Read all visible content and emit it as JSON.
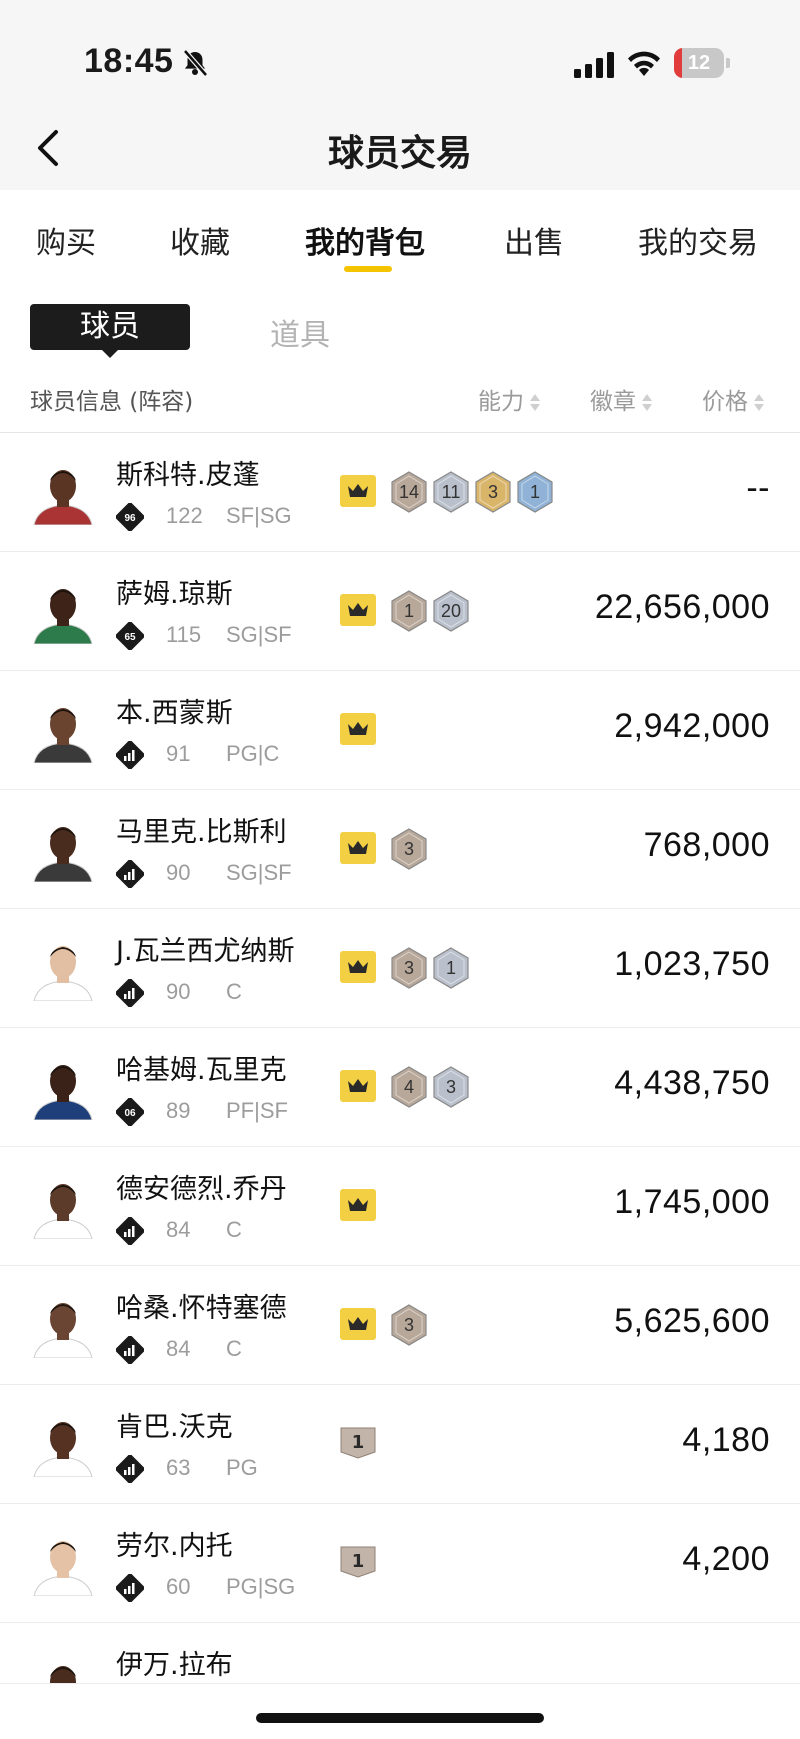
{
  "status_bar": {
    "time": "18:45",
    "battery": "12"
  },
  "nav": {
    "title": "球员交易"
  },
  "tabs": [
    {
      "label": "购买"
    },
    {
      "label": "收藏"
    },
    {
      "label": "我的背包",
      "active": true
    },
    {
      "label": "出售"
    },
    {
      "label": "我的交易"
    }
  ],
  "subtabs": {
    "active": "球员",
    "other": "道具"
  },
  "columns": {
    "info": "球员信息 (阵容)",
    "ability": "能力",
    "badge": "徽章",
    "price": "价格"
  },
  "colors": {
    "accent": "#f5c400",
    "crown": "#f2cf43",
    "bronze": "#b8a89a",
    "silver": "#b9c0cc",
    "gold": "#d9b56a",
    "blue": "#8fb2d6"
  },
  "players": [
    {
      "name": "斯科特.皮蓬",
      "tier": "96",
      "rating": "122",
      "position": "SF|SG",
      "badges": [
        {
          "type": "crown"
        },
        {
          "type": "hex",
          "color": "bronze",
          "value": "14"
        },
        {
          "type": "hex",
          "color": "silver",
          "value": "11"
        },
        {
          "type": "hex",
          "color": "gold",
          "value": "3"
        },
        {
          "type": "hex",
          "color": "blue",
          "value": "1"
        }
      ],
      "price": "--"
    },
    {
      "name": "萨姆.琼斯",
      "tier": "65",
      "rating": "115",
      "position": "SG|SF",
      "badges": [
        {
          "type": "crown"
        },
        {
          "type": "hex",
          "color": "bronze",
          "value": "1"
        },
        {
          "type": "hex",
          "color": "silver",
          "value": "20"
        }
      ],
      "price": "22,656,000"
    },
    {
      "name": "本.西蒙斯",
      "tier": "bars",
      "rating": "91",
      "position": "PG|C",
      "badges": [
        {
          "type": "crown"
        }
      ],
      "price": "2,942,000"
    },
    {
      "name": "马里克.比斯利",
      "tier": "bars",
      "rating": "90",
      "position": "SG|SF",
      "badges": [
        {
          "type": "crown"
        },
        {
          "type": "hex",
          "color": "bronze",
          "value": "3"
        }
      ],
      "price": "768,000"
    },
    {
      "name": "J.瓦兰西尤纳斯",
      "tier": "bars",
      "rating": "90",
      "position": "C",
      "badges": [
        {
          "type": "crown"
        },
        {
          "type": "hex",
          "color": "bronze",
          "value": "3"
        },
        {
          "type": "hex",
          "color": "silver",
          "value": "1"
        }
      ],
      "price": "1,023,750"
    },
    {
      "name": "哈基姆.瓦里克",
      "tier": "06",
      "rating": "89",
      "position": "PF|SF",
      "badges": [
        {
          "type": "crown"
        },
        {
          "type": "hex",
          "color": "bronze",
          "value": "4"
        },
        {
          "type": "hex",
          "color": "silver",
          "value": "3"
        }
      ],
      "price": "4,438,750"
    },
    {
      "name": "德安德烈.乔丹",
      "tier": "bars",
      "rating": "84",
      "position": "C",
      "badges": [
        {
          "type": "crown"
        }
      ],
      "price": "1,745,000"
    },
    {
      "name": "哈桑.怀特塞德",
      "tier": "bars",
      "rating": "84",
      "position": "C",
      "badges": [
        {
          "type": "crown"
        },
        {
          "type": "hex",
          "color": "bronze",
          "value": "3"
        }
      ],
      "price": "5,625,600"
    },
    {
      "name": "肯巴.沃克",
      "tier": "bars",
      "rating": "63",
      "position": "PG",
      "badges": [
        {
          "type": "tag",
          "value": "1"
        }
      ],
      "price": "4,180"
    },
    {
      "name": "劳尔.内托",
      "tier": "bars",
      "rating": "60",
      "position": "PG|SG",
      "badges": [
        {
          "type": "tag",
          "value": "1"
        }
      ],
      "price": "4,200"
    }
  ],
  "partial_player": {
    "name": "伊万.拉布"
  }
}
